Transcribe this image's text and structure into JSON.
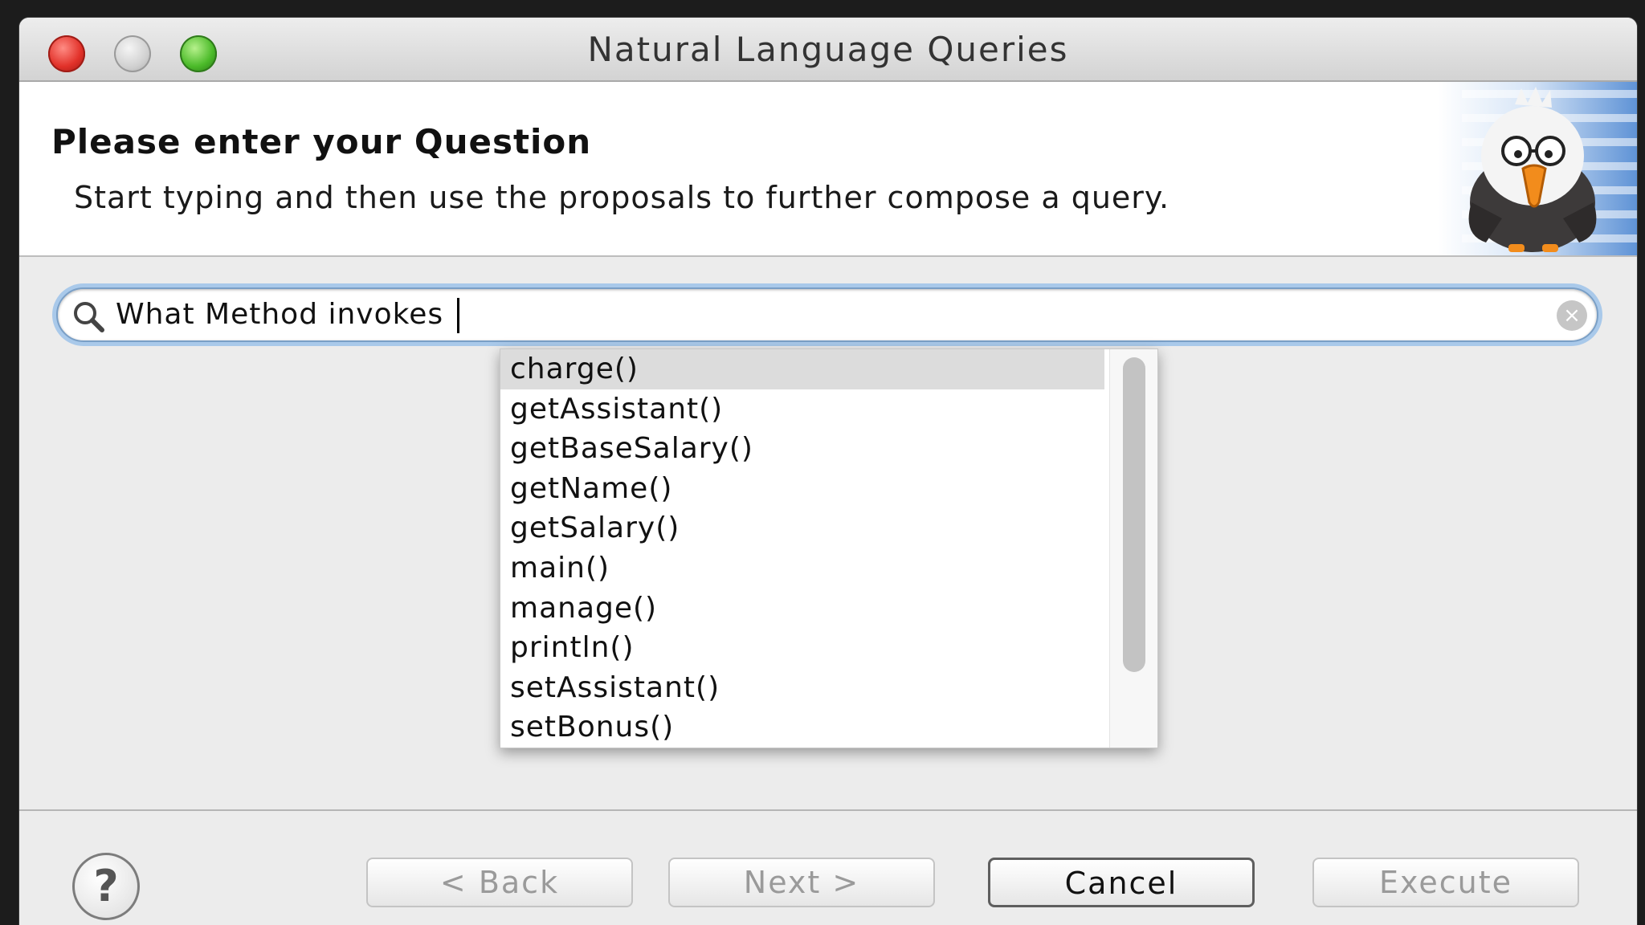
{
  "window": {
    "title": "Natural Language Queries"
  },
  "banner": {
    "heading": "Please enter your Question",
    "description": "Start typing and then use the proposals to further compose a query."
  },
  "search": {
    "value": "What Method invokes "
  },
  "proposals": {
    "selected_index": 0,
    "items": [
      "charge()",
      "getAssistant()",
      "getBaseSalary()",
      "getName()",
      "getSalary()",
      "main()",
      "manage()",
      "println()",
      "setAssistant()",
      "setBonus()"
    ]
  },
  "buttons": {
    "help": "?",
    "back": "< Back",
    "next": "Next >",
    "cancel": "Cancel",
    "execute": "Execute"
  },
  "colors": {
    "focus_ring": "#a9c9ea",
    "selected_row": "#dcdcdc",
    "close": "#e2322a",
    "zoom": "#4cbb2a"
  }
}
